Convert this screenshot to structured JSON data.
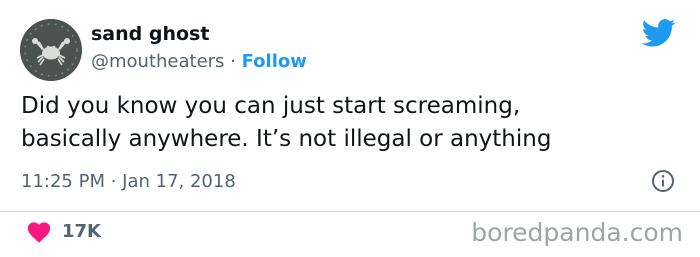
{
  "tweet": {
    "display_name": "sand ghost",
    "handle": "@moutheaters",
    "separator": " · ",
    "follow_label": "Follow",
    "text_line1": "Did you know you can just start screaming,",
    "text_line2": "basically anywhere. It’s not illegal or anything",
    "timestamp": "11:25 PM · Jan 17, 2018",
    "likes": "17K"
  },
  "icons": {
    "avatar": "crab-avatar",
    "brand": "twitter-bird-icon",
    "info": "info-icon",
    "like": "heart-icon"
  },
  "watermark": "boredpanda.com",
  "colors": {
    "twitter_blue": "#1d9bf0",
    "heart_pink": "#f91880",
    "text_primary": "#0f1419",
    "text_secondary": "#536471",
    "watermark_gray": "#9ea5a8"
  }
}
